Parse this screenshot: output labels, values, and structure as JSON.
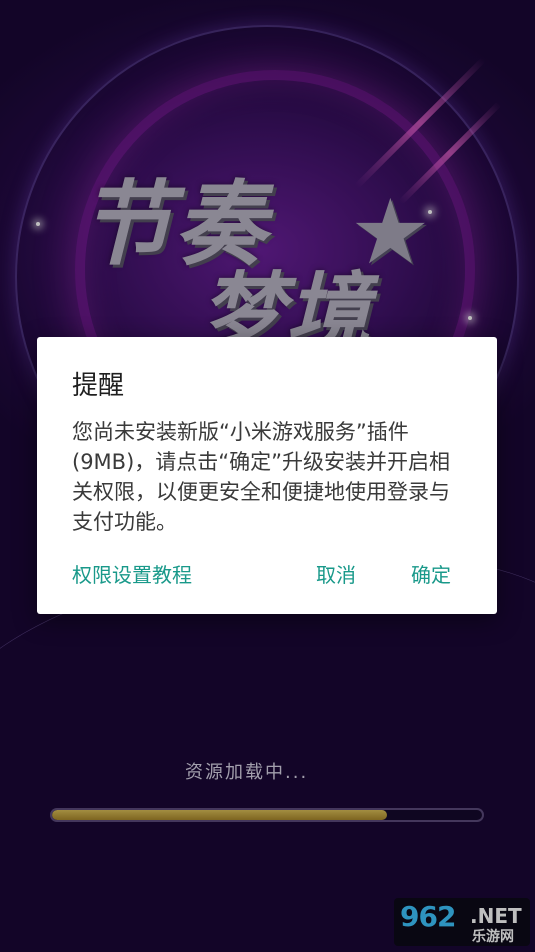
{
  "splash": {
    "logo_line1": "节奏",
    "logo_line2": "梦境",
    "loading_text": "资源加载中...",
    "progress": 0.78
  },
  "dialog": {
    "title": "提醒",
    "message": "您尚未安装新版“小米游戏服务”插件(9MB)，请点击“确定”升级安装并开启相关权限，以便更安全和便捷地使用登录与支付功能。",
    "tutorial_label": "权限设置教程",
    "cancel_label": "取消",
    "confirm_label": "确定"
  },
  "watermark": {
    "digits": "962",
    "net": ".NET",
    "sub": "乐游网"
  },
  "colors": {
    "accent": "#19998a",
    "progress": "#c9a843",
    "background": "#2a0a4a"
  }
}
